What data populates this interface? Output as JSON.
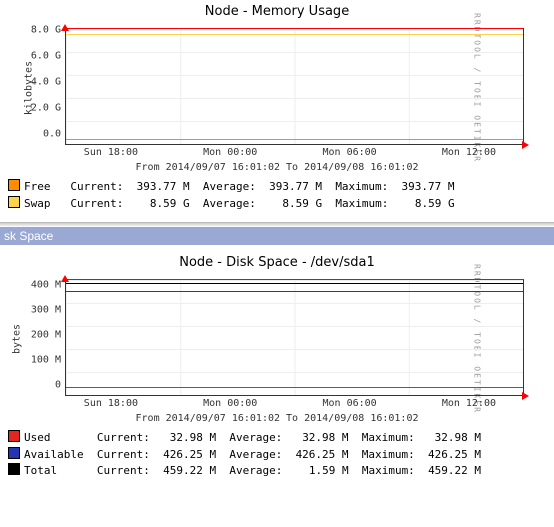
{
  "chart_data": [
    {
      "type": "line",
      "title": "Node - Memory Usage",
      "xlabel": "",
      "ylabel": "kilobytes",
      "ylim": [
        0,
        9
      ],
      "yticks": [
        "0.0",
        "2.0 G",
        "4.0 G",
        "6.0 G",
        "8.0 G"
      ],
      "yticks_vals": [
        0,
        2,
        4,
        6,
        8
      ],
      "xticks": [
        "Sun 18:00",
        "Mon 00:00",
        "Mon 06:00",
        "Mon 12:00"
      ],
      "range": "From 2014/09/07 16:01:02 To 2014/09/08 16:01:02",
      "series": [
        {
          "name": "Free",
          "color": "#ff8c00",
          "current": "393.77 M",
          "average": "393.77 M",
          "maximum": "393.77 M",
          "flat_value_g": 0.394
        },
        {
          "name": "Swap",
          "color": "#ffd24d",
          "current": "8.59 G",
          "average": "8.59 G",
          "maximum": "8.59 G",
          "flat_value_g": 8.59
        }
      ]
    },
    {
      "type": "line",
      "title": "Node - Disk Space - /dev/sda1",
      "xlabel": "",
      "ylabel": "bytes",
      "ylim": [
        0,
        470
      ],
      "yticks": [
        "0",
        "100 M",
        "200 M",
        "300 M",
        "400 M"
      ],
      "yticks_vals": [
        0,
        100,
        200,
        300,
        400
      ],
      "xticks": [
        "Sun 18:00",
        "Mon 00:00",
        "Mon 06:00",
        "Mon 12:00"
      ],
      "range": "From 2014/09/07 16:01:02 To 2014/09/08 16:01:02",
      "series": [
        {
          "name": "Used",
          "color": "#e52620",
          "current": "32.98 M",
          "average": "32.98 M",
          "maximum": "32.98 M",
          "flat_value_m": 32.98
        },
        {
          "name": "Available",
          "color": "#2434b3",
          "current": "426.25 M",
          "average": "426.25 M",
          "maximum": "426.25 M",
          "flat_value_m": 426.25
        },
        {
          "name": "Total",
          "color": "#000000",
          "current": "459.22 M",
          "average": "1.59 M",
          "maximum": "459.22 M",
          "flat_value_m": 459.22
        }
      ]
    }
  ],
  "section_header": "sk Space",
  "watermark": "RRDTOOL / TOBI OETIKER",
  "legend_labels": {
    "current": "Current:",
    "average": "Average:",
    "maximum": "Maximum:"
  }
}
